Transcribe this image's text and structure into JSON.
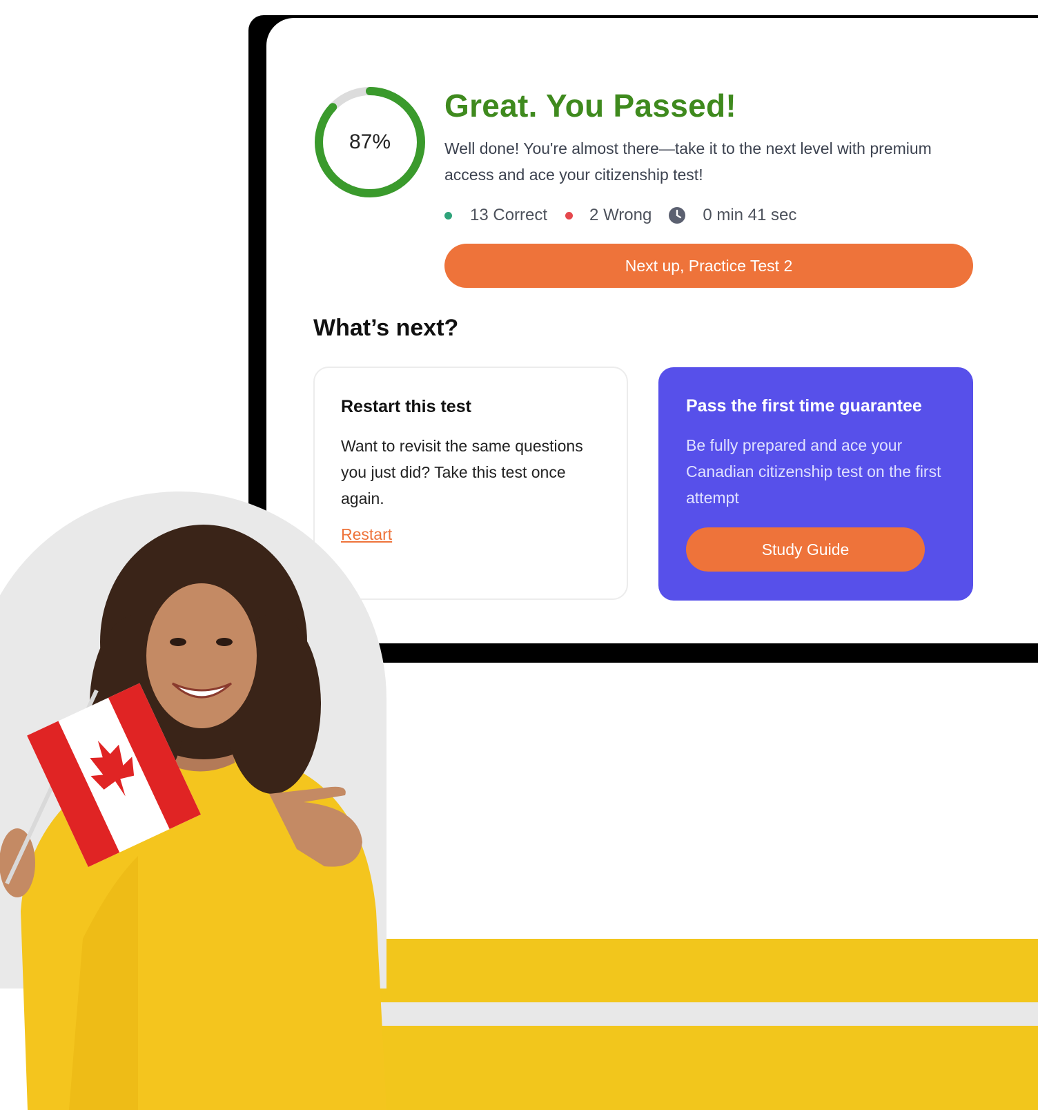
{
  "result": {
    "percent_label": "87%",
    "percent_value": 87,
    "title": "Great. You Passed!",
    "message": "Well done! You're almost there—take it to the next level with premium access and ace your citizenship test!",
    "correct_label": "13 Correct",
    "wrong_label": "2 Wrong",
    "time_label": "0 min 41 sec",
    "next_button": "Next up, Practice Test 2"
  },
  "whats_next": {
    "heading": "What’s next?",
    "restart_card": {
      "title": "Restart this test",
      "body": "Want to revisit the same questions you just did? Take this test once again.",
      "link": "Restart"
    },
    "guarantee_card": {
      "title": "Pass the first time guarantee",
      "body": "Be fully prepared and ace your Canadian citizenship test on the first attempt",
      "button": "Study Guide"
    }
  },
  "colors": {
    "accent_orange": "#ee733a",
    "success_green": "#3f8a1e",
    "ring_green": "#3a9a2c",
    "card_purple": "#5750ea",
    "correct_dot": "#2fa37a",
    "wrong_dot": "#e5484d"
  },
  "icons": [
    "clock-icon",
    "maple-leaf-icon"
  ]
}
